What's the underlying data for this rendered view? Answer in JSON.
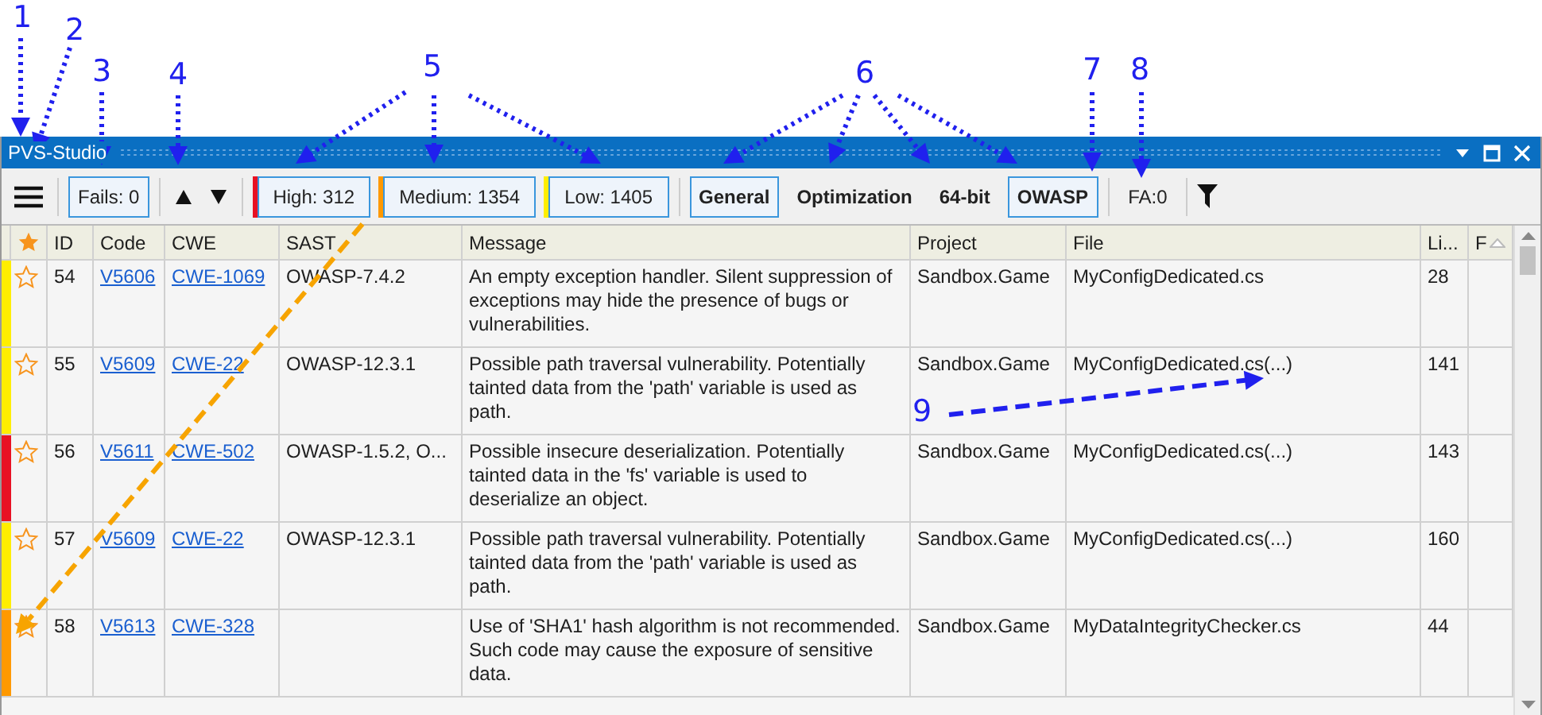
{
  "annotations": [
    "1",
    "2",
    "3",
    "4",
    "5",
    "6",
    "7",
    "8",
    "9"
  ],
  "window": {
    "title": "PVS-Studio"
  },
  "toolbar": {
    "fails": {
      "label": "Fails: 0",
      "selected": true
    },
    "severity_filters": [
      {
        "label": "High: 312",
        "color": "#e81123",
        "selected": true
      },
      {
        "label": "Medium: 1354",
        "color": "#ff9900",
        "selected": true
      },
      {
        "label": "Low: 1405",
        "color": "#ffee00",
        "selected": true
      }
    ],
    "groups": [
      {
        "label": "General",
        "selected": true
      },
      {
        "label": "Optimization",
        "selected": false
      },
      {
        "label": "64-bit",
        "selected": false
      },
      {
        "label": "OWASP",
        "selected": true
      }
    ],
    "fa": "FA:0"
  },
  "table": {
    "columns": [
      "ID",
      "Code",
      "CWE",
      "SAST",
      "Message",
      "Project",
      "File",
      "Li...",
      "F"
    ],
    "rows": [
      {
        "color": "#ffee00",
        "favorite": false,
        "id": "54",
        "code": "V5606",
        "cwe": "CWE-1069",
        "sast": "OWASP-7.4.2",
        "message": "An empty exception handler. Silent suppression of exceptions may hide the presence of bugs or vulnerabilities.",
        "project": "Sandbox.Game",
        "file": "MyConfigDedicated.cs",
        "line": "28"
      },
      {
        "color": "#ffee00",
        "favorite": false,
        "id": "55",
        "code": "V5609",
        "cwe": "CWE-22",
        "sast": "OWASP-12.3.1",
        "message": "Possible path traversal vulnerability. Potentially tainted data from the 'path' variable is used as path.",
        "project": "Sandbox.Game",
        "file": "MyConfigDedicated.cs(...)",
        "line": "141"
      },
      {
        "color": "#e81123",
        "favorite": false,
        "id": "56",
        "code": "V5611",
        "cwe": "CWE-502",
        "sast": "OWASP-1.5.2, O...",
        "message": "Possible insecure deserialization. Potentially tainted data in the 'fs' variable is used to deserialize an object.",
        "project": "Sandbox.Game",
        "file": "MyConfigDedicated.cs(...)",
        "line": "143"
      },
      {
        "color": "#ffee00",
        "favorite": false,
        "id": "57",
        "code": "V5609",
        "cwe": "CWE-22",
        "sast": "OWASP-12.3.1",
        "message": "Possible path traversal vulnerability. Potentially tainted data from the 'path' variable is used as path.",
        "project": "Sandbox.Game",
        "file": "MyConfigDedicated.cs(...)",
        "line": "160"
      },
      {
        "color": "#ff9900",
        "favorite": false,
        "id": "58",
        "code": "V5613",
        "cwe": "CWE-328",
        "sast": "",
        "message": "Use of 'SHA1' hash algorithm is not recommended. Such code may cause the exposure of sensitive data.",
        "project": "Sandbox.Game",
        "file": "MyDataIntegrityChecker.cs",
        "line": "44"
      }
    ]
  }
}
